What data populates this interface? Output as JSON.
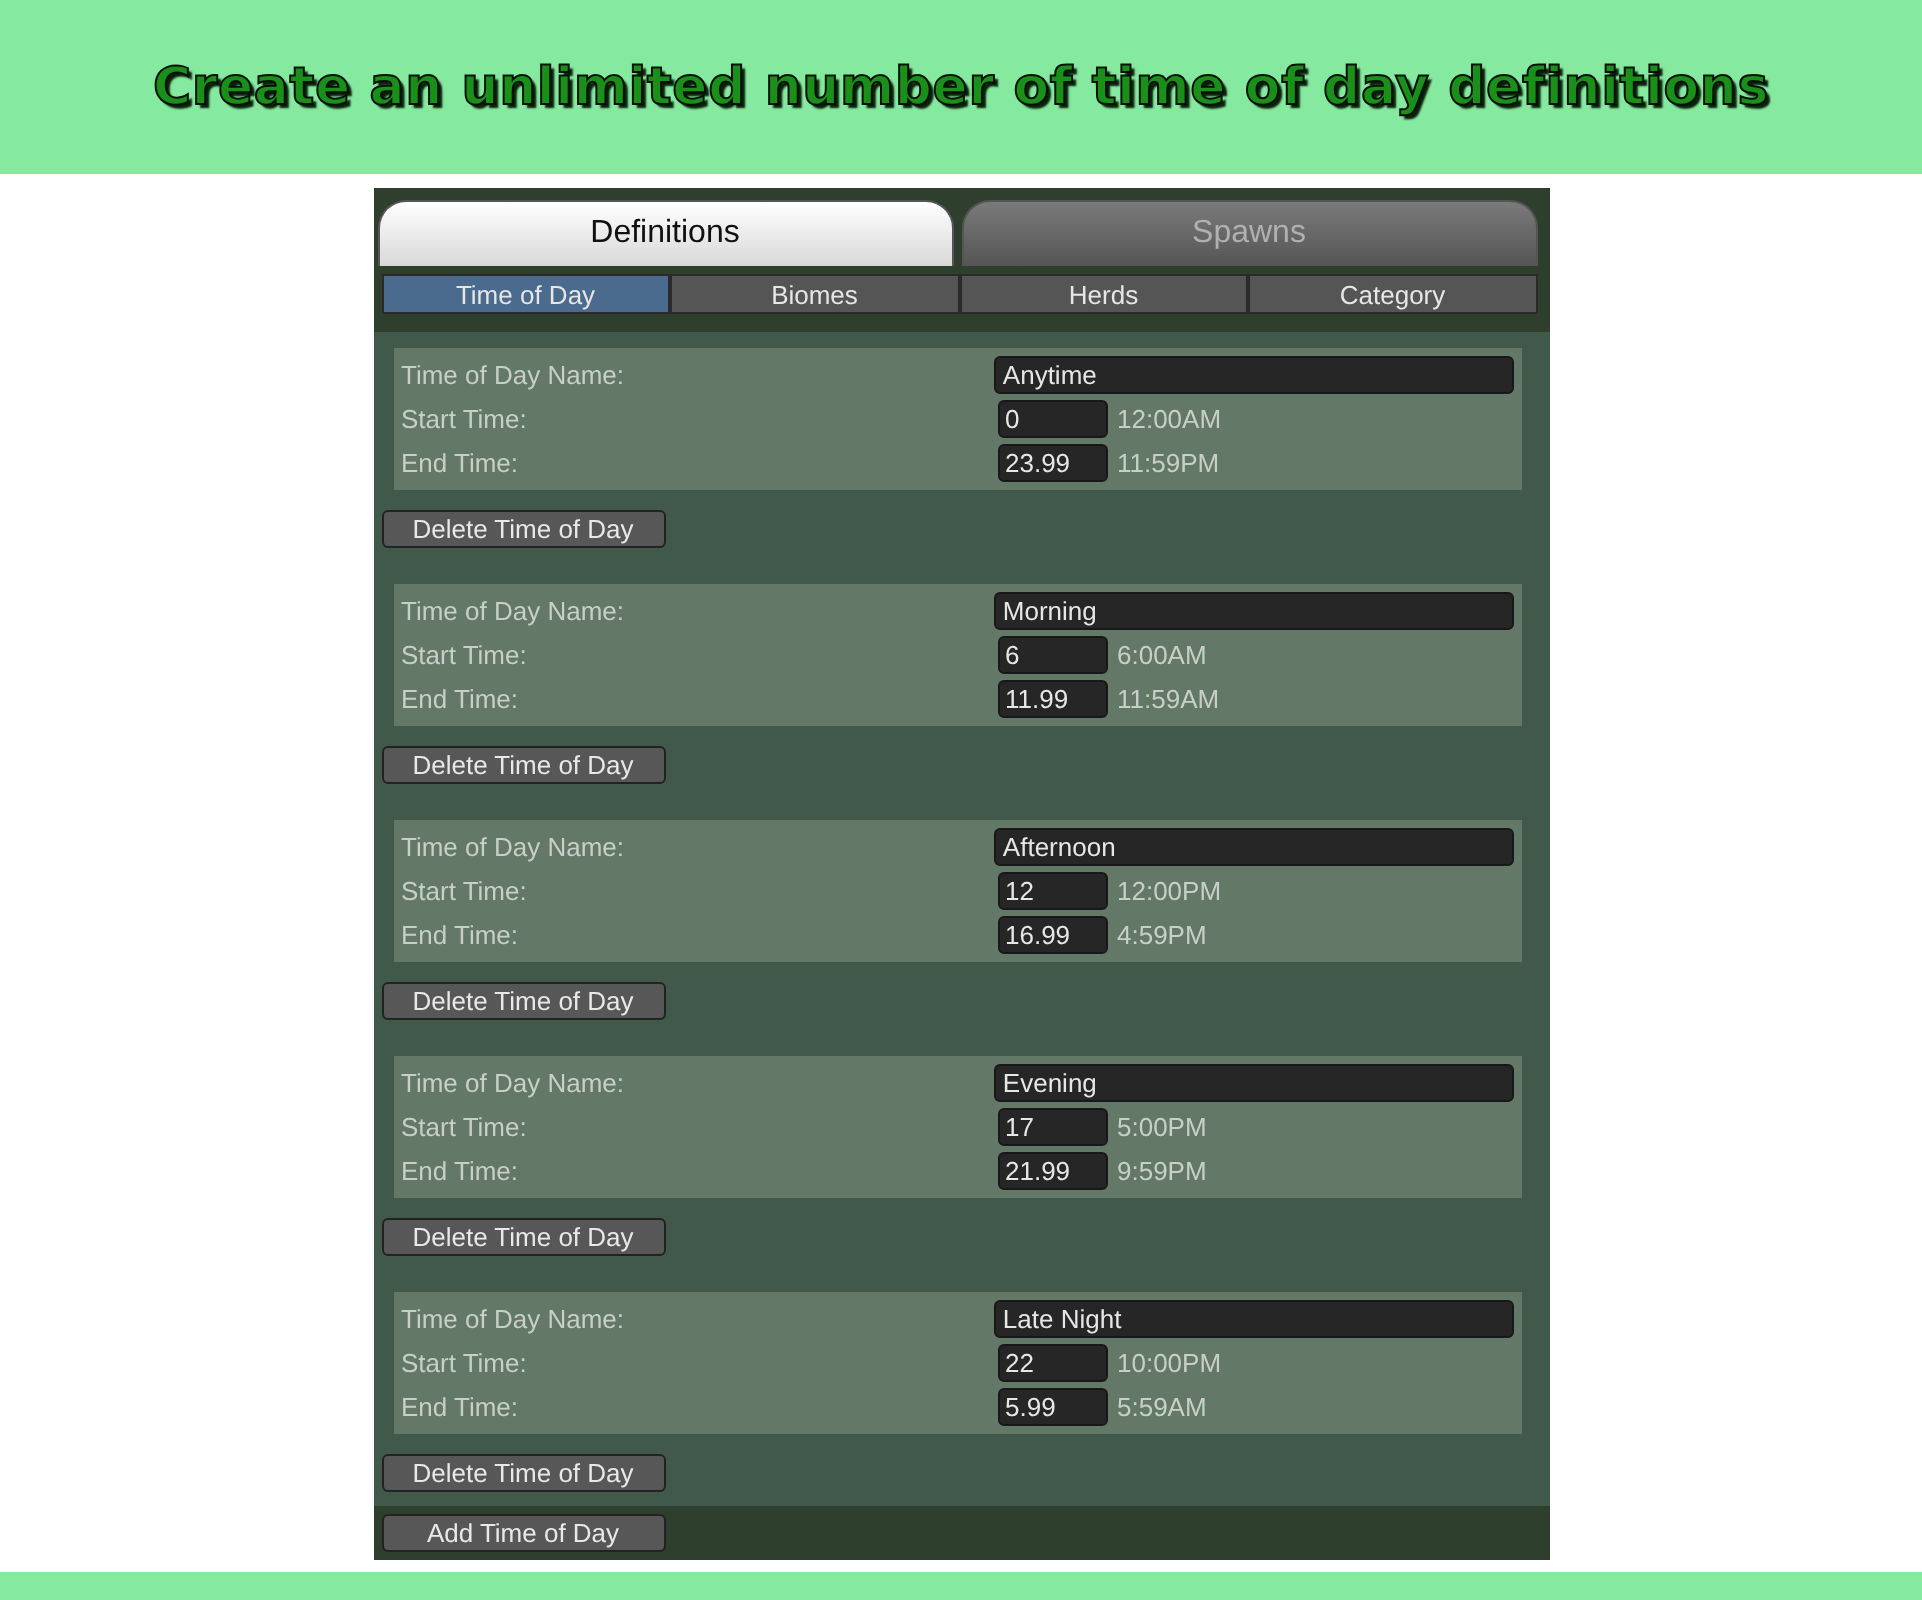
{
  "banner": {
    "title": "Create an unlimited number of time of day definitions"
  },
  "tabs": [
    {
      "label": "Definitions",
      "selected": true
    },
    {
      "label": "Spawns",
      "selected": false
    }
  ],
  "subtabs": [
    {
      "label": "Time of Day",
      "selected": true
    },
    {
      "label": "Biomes",
      "selected": false
    },
    {
      "label": "Herds",
      "selected": false
    },
    {
      "label": "Category",
      "selected": false
    }
  ],
  "entries": [
    {
      "name_label": "Time of Day Name:",
      "name": "Anytime",
      "start_label": "Start Time:",
      "start": "0",
      "start_clock": "12:00AM",
      "end_label": "End Time:",
      "end": "23.99",
      "end_clock": "11:59PM",
      "delete_button": "Delete Time of Day"
    },
    {
      "name_label": "Time of Day Name:",
      "name": "Morning",
      "start_label": "Start Time:",
      "start": "6",
      "start_clock": "6:00AM",
      "end_label": "End Time:",
      "end": "11.99",
      "end_clock": "11:59AM",
      "delete_button": "Delete Time of Day"
    },
    {
      "name_label": "Time of Day Name:",
      "name": "Afternoon",
      "start_label": "Start Time:",
      "start": "12",
      "start_clock": "12:00PM",
      "end_label": "End Time:",
      "end": "16.99",
      "end_clock": "4:59PM",
      "delete_button": "Delete Time of Day"
    },
    {
      "name_label": "Time of Day Name:",
      "name": "Evening",
      "start_label": "Start Time:",
      "start": "17",
      "start_clock": "5:00PM",
      "end_label": "End Time:",
      "end": "21.99",
      "end_clock": "9:59PM",
      "delete_button": "Delete Time of Day"
    },
    {
      "name_label": "Time of Day Name:",
      "name": "Late Night",
      "start_label": "Start Time:",
      "start": "22",
      "start_clock": "10:00PM",
      "end_label": "End Time:",
      "end": "5.99",
      "end_clock": "5:59AM",
      "delete_button": "Delete Time of Day"
    }
  ],
  "add_button": "Add Time of Day"
}
